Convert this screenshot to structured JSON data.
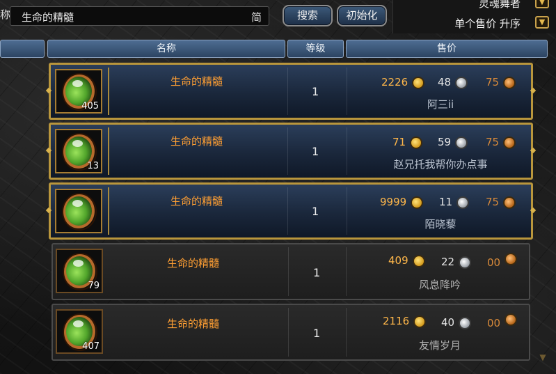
{
  "search": {
    "label_fragment": "称",
    "query": "生命的精髓",
    "simplified_toggle": "简"
  },
  "buttons": {
    "search": "搜索",
    "reset": "初始化"
  },
  "filters": {
    "job": "灵魂舞者",
    "sort": "单个售价 升序"
  },
  "columns": {
    "name": "名称",
    "level": "等级",
    "price": "售价"
  },
  "listings": [
    {
      "name": "生命的精髓",
      "level": "1",
      "quantity": "405",
      "gold": "2226",
      "silver": "48",
      "copper": "75",
      "seller": "阿三ii",
      "highlight": true
    },
    {
      "name": "生命的精髓",
      "level": "1",
      "quantity": "13",
      "gold": "71",
      "silver": "59",
      "copper": "75",
      "seller": "赵兄托我帮你办点事",
      "highlight": true
    },
    {
      "name": "生命的精髓",
      "level": "1",
      "quantity": "",
      "gold": "9999",
      "silver": "11",
      "copper": "75",
      "seller": "陌晓藜",
      "highlight": true
    },
    {
      "name": "生命的精髓",
      "level": "1",
      "quantity": "79",
      "gold": "409",
      "silver": "22",
      "copper": "00",
      "seller": "风息降吟",
      "highlight": false
    },
    {
      "name": "生命的精髓",
      "level": "1",
      "quantity": "407",
      "gold": "2116",
      "silver": "40",
      "copper": "00",
      "seller": "友情岁月",
      "highlight": false
    }
  ],
  "colors": {
    "gold_border": "#b9963c",
    "item_name": "#ff9f33",
    "price_gold": "#ffb74a",
    "header_blue": "#3d5a7a"
  },
  "icons": {
    "coin_gold": "gold-coin-icon",
    "coin_silver": "silver-coin-icon",
    "coin_copper": "copper-coin-icon",
    "item": "life-essence-orb-icon"
  }
}
